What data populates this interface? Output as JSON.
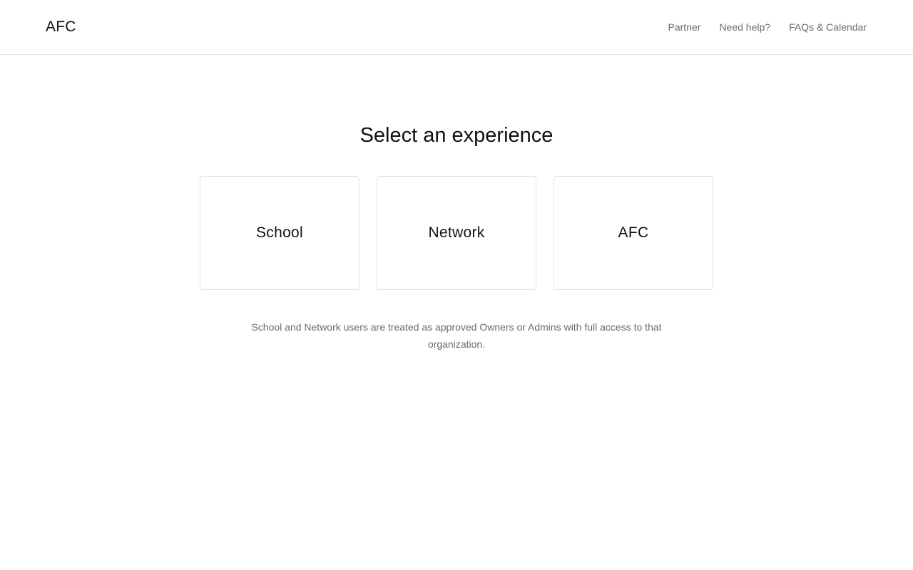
{
  "header": {
    "brand": "AFC",
    "nav": [
      {
        "label": "Partner"
      },
      {
        "label": "Need help?"
      },
      {
        "label": "FAQs & Calendar"
      }
    ]
  },
  "main": {
    "title": "Select an experience",
    "cards": [
      {
        "label": "School"
      },
      {
        "label": "Network"
      },
      {
        "label": "AFC"
      }
    ],
    "note": "School and Network users are treated as approved Owners or Admins with full access to that organization."
  },
  "colors": {
    "text_primary": "#111111",
    "text_muted": "#6b6b6b",
    "border": "#e2e2e2",
    "background": "#ffffff"
  }
}
